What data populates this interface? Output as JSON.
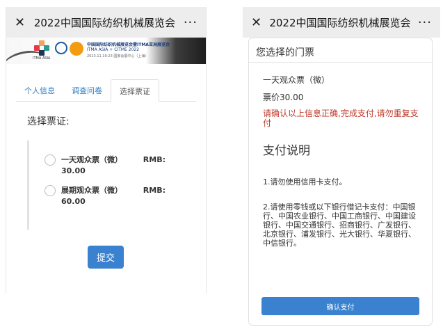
{
  "left": {
    "header": {
      "close_icon": "close-icon",
      "title": "2022中国国际纺织机械展览会",
      "more_icon": "more-icon"
    },
    "banner": {
      "line1": "中国国际纺织机械展览会暨ITMA亚洲展览会",
      "line2": "ITMA ASIA + CITME 2022",
      "line3": "2023.11.19-23  国家会展中心（上海）",
      "logo_text": "ITMA ASIA"
    },
    "tabs": [
      {
        "label": "个人信息"
      },
      {
        "label": "调查问卷"
      },
      {
        "label": "选择票证"
      }
    ],
    "section_label": "选择票证:",
    "options": [
      {
        "name": "一天观众票（微）",
        "price_label": "RMB:",
        "price": "30.00"
      },
      {
        "name": "展期观众票（微）",
        "price_label": "RMB:",
        "price": "60.00"
      }
    ],
    "submit_label": "提交"
  },
  "right": {
    "header": {
      "close_icon": "close-icon",
      "title": "2022中国国际纺织机械展览会",
      "more_icon": "more-icon"
    },
    "card_title": "您选择的门票",
    "ticket_name": "一天观众票（微）",
    "ticket_price": "票价30.00",
    "warning": "请确认以上信息正确,完成支付,请勿重复支付",
    "pay_title": "支付说明",
    "pay_note1": "1.请勿使用信用卡支付。",
    "pay_note2": "2.请使用零钱或以下银行借记卡支付：中国银行、中国农业银行、中国工商银行、中国建设银行、中国交通银行、招商银行、广发银行、北京银行、浦发银行、光大银行、华夏银行、中信银行。",
    "confirm_label": "确认支付"
  },
  "colors": {
    "accent": "#3a82d0",
    "warning": "#c0392b",
    "tab_link": "#2b7cc6"
  }
}
